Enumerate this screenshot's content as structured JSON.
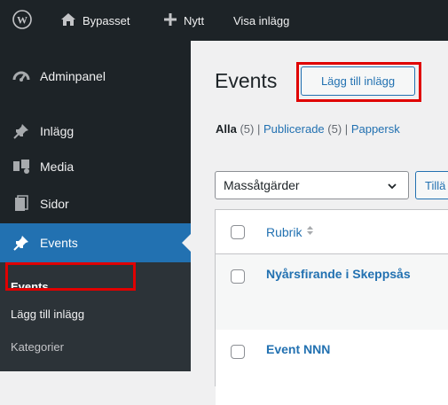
{
  "adminbar": {
    "wp_logo_icon": "wordpress-logo-icon",
    "site_name": "Bypasset",
    "new_label": "Nytt",
    "view_label": "Visa inlägg"
  },
  "sidebar": {
    "items": [
      {
        "label": "Adminpanel",
        "icon": "dashboard-icon"
      },
      {
        "label": "Inlägg",
        "icon": "pin-icon"
      },
      {
        "label": "Media",
        "icon": "media-icon"
      },
      {
        "label": "Sidor",
        "icon": "pages-icon"
      },
      {
        "label": "Events",
        "icon": "pin-icon",
        "current": true
      }
    ],
    "submenu": [
      {
        "label": "Events",
        "current": true
      },
      {
        "label": "Lägg till inlägg"
      },
      {
        "label": "Kategorier"
      }
    ]
  },
  "main": {
    "title": "Events",
    "add_button": "Lägg till inlägg",
    "filters": {
      "all_label": "Alla",
      "all_count": "(5)",
      "separator": "|",
      "published_label": "Publicerade",
      "published_count": "(5)",
      "trash_label": "Pappersk"
    },
    "bulk_actions": {
      "selected": "Massåtgärder"
    },
    "apply_button": "Tillä",
    "table": {
      "column_title": "Rubrik",
      "rows": [
        {
          "title": "Nyårsfirande i Skeppsås"
        },
        {
          "title": "Event NNN"
        }
      ]
    }
  },
  "colors": {
    "adminbar_bg": "#1d2327",
    "sidebar_bg": "#1d2327",
    "submenu_bg": "#2c3338",
    "accent": "#2271b1",
    "highlight_box": "#e00000"
  }
}
